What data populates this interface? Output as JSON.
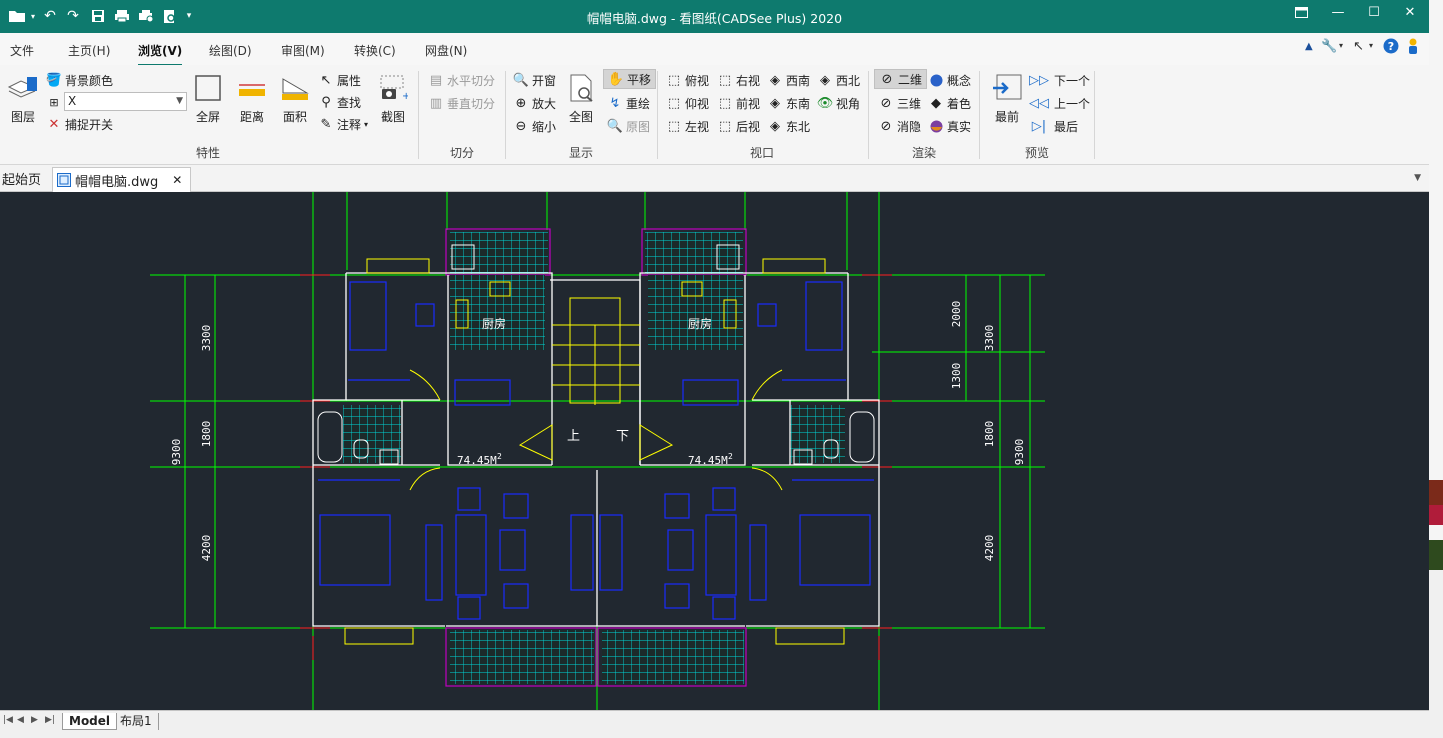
{
  "titlebar": {
    "title": "帽帽电脑.dwg - 看图纸(CADSee Plus) 2020",
    "quick_access": [
      "open-folder-icon",
      "undo-icon",
      "redo-icon",
      "save-icon",
      "print-icon",
      "print-preview-icon",
      "batch-print-icon",
      "more-icon"
    ]
  },
  "menu": {
    "items": [
      "文件",
      "主页(H)",
      "浏览(V)",
      "绘图(D)",
      "审图(M)",
      "转换(C)",
      "网盘(N)"
    ],
    "active": "浏览(V)"
  },
  "ribbon": {
    "groups": {
      "properties": {
        "label": "特性",
        "layer": "图层",
        "bg_color": "背景颜色",
        "combo_value": "X",
        "snap": "捕捉开关",
        "fullscreen": "全屏",
        "distance": "距离",
        "area": "面积",
        "attributes": "属性",
        "find": "查找",
        "annotate": "注释",
        "screenshot": "截图"
      },
      "split": {
        "label": "切分",
        "horizontal": "水平切分",
        "vertical": "垂直切分"
      },
      "display": {
        "label": "显示",
        "open_window": "开窗",
        "zoom_in": "放大",
        "zoom_out": "缩小",
        "full_view": "全图",
        "pan": "平移",
        "redraw": "重绘",
        "original": "原图"
      },
      "viewport": {
        "label": "视口",
        "top": "俯视",
        "right": "右视",
        "southwest": "西南",
        "northwest": "西北",
        "bottom": "仰视",
        "front": "前视",
        "southeast": "东南",
        "view_angle": "视角",
        "left": "左视",
        "back": "后视",
        "northeast": "东北"
      },
      "render": {
        "label": "渲染",
        "two_d": "二维",
        "concept": "概念",
        "three_d": "三维",
        "shaded": "着色",
        "hidden": "消隐",
        "realistic": "真实"
      },
      "preview": {
        "label": "预览",
        "first": "最前",
        "next": "下一个",
        "prev": "上一个",
        "last": "最后"
      }
    }
  },
  "tabs": {
    "home": "起始页",
    "file": "帽帽电脑.dwg"
  },
  "drawing": {
    "room_kitchen": "厨房",
    "area_label": "74.45M",
    "area_sup": "2",
    "stair_up": "上",
    "stair_down": "下",
    "dims_left": [
      "3300",
      "1800",
      "4200",
      "9300"
    ],
    "dims_right": [
      "2000",
      "1300",
      "3300",
      "1800",
      "9300",
      "4200"
    ]
  },
  "layout_tabs": [
    "Model",
    "布局1"
  ],
  "colors": {
    "titlebar": "#0e7a6e",
    "canvas_bg": "#212830",
    "wall": "#ffffff",
    "axis": "#00ff00",
    "furniture": "#1a2bff",
    "tile": "#00e0e0",
    "window": "#ffff00",
    "balcony": "#c000c0",
    "dim_line": "#ff2020"
  }
}
